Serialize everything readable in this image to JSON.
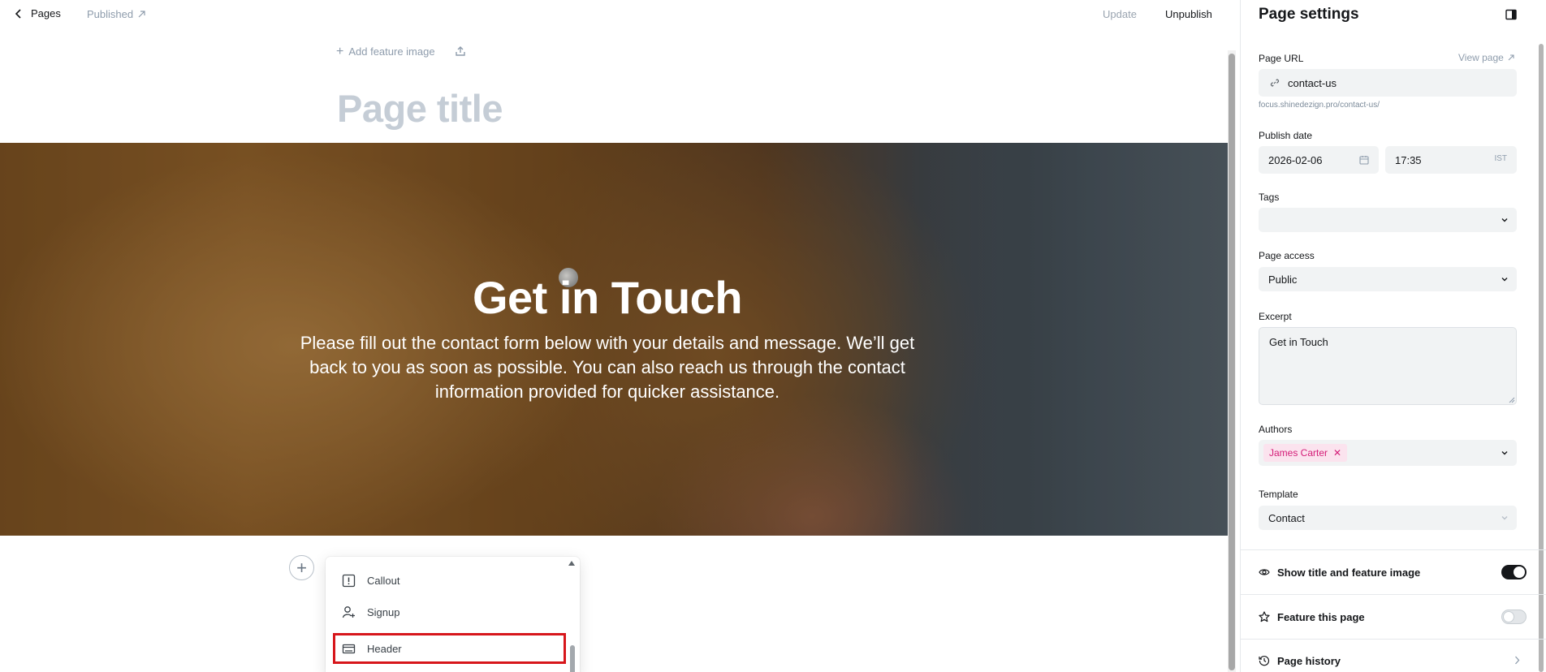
{
  "topbar": {
    "back_label": "Pages",
    "status": "Published",
    "update_label": "Update",
    "unpublish_label": "Unpublish"
  },
  "editor": {
    "add_feature_image": "Add feature image",
    "title_placeholder": "Page title",
    "hero": {
      "title": "Get in Touch",
      "text": "Please fill out the contact form below with your details and message. We’ll get back to you as soon as possible. You can also reach us through the contact information provided for quicker assistance."
    },
    "card_menu": [
      {
        "label": "Callout",
        "icon": "callout-icon"
      },
      {
        "label": "Signup",
        "icon": "signup-icon"
      },
      {
        "label": "Header",
        "icon": "header-icon"
      }
    ]
  },
  "settings": {
    "title": "Page settings",
    "page_url_label": "Page URL",
    "view_page_label": "View page",
    "page_url_value": "contact-us",
    "page_url_hint": "focus.shinedezign.pro/contact-us/",
    "publish_date_label": "Publish date",
    "publish_date_value": "2026-02-06",
    "publish_time_value": "17:35",
    "timezone": "IST",
    "tags_label": "Tags",
    "page_access_label": "Page access",
    "page_access_value": "Public",
    "excerpt_label": "Excerpt",
    "excerpt_value": "Get in Touch",
    "authors_label": "Authors",
    "author_chip": "James Carter",
    "template_label": "Template",
    "template_value": "Contact",
    "show_title_label": "Show title and feature image",
    "show_title_on": true,
    "feature_label": "Feature this page",
    "feature_on": false,
    "history_label": "Page history"
  },
  "colors": {
    "accent_pink": "#d41d78",
    "highlight_red": "#d7161b"
  }
}
